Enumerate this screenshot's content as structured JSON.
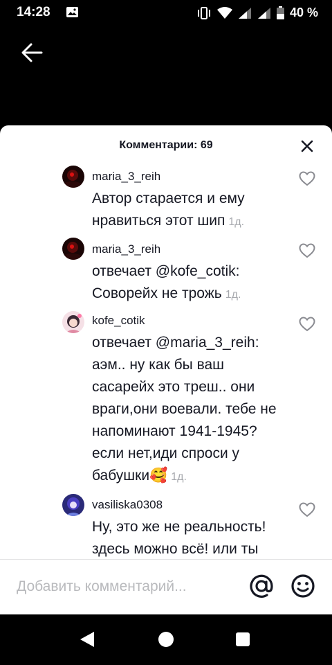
{
  "status_bar": {
    "time": "14:28",
    "battery_percent": "40 %",
    "icons": [
      "image-icon",
      "vibrate-icon",
      "wifi-icon",
      "signal-icon",
      "signal-icon",
      "battery-icon"
    ]
  },
  "header": {
    "back_icon": "arrow-left-icon"
  },
  "sheet": {
    "title": "Комментарии: 69",
    "close_icon": "close-icon"
  },
  "comments": [
    {
      "username": "maria_3_reih",
      "text": "Автор старается и ему нравиться этот шип",
      "time": "1д."
    },
    {
      "username": "maria_3_reih",
      "prefix": "отвечает ",
      "mention": "@kofe_cotik",
      "text": ": Соворейх не трожь",
      "time": "1д."
    },
    {
      "username": "kofe_cotik",
      "prefix": "отвечает ",
      "mention": "@maria_3_reih",
      "text": ": аэм.. ну как бы ваш сасарейх это треш.. они враги,они воевали. тебе не напоминают 1941-1945? если нет,иди спроси у бабушки🥰",
      "time": "1д."
    },
    {
      "username": "vasiliska0308",
      "text": "Ну, это же не реальность! здесь можно всё! или ты",
      "time": ""
    }
  ],
  "input": {
    "placeholder": "Добавить комментарий..."
  },
  "colors": {
    "accent_text": "#161823",
    "muted": "#a7a9ae",
    "placeholder": "#b9babd"
  }
}
